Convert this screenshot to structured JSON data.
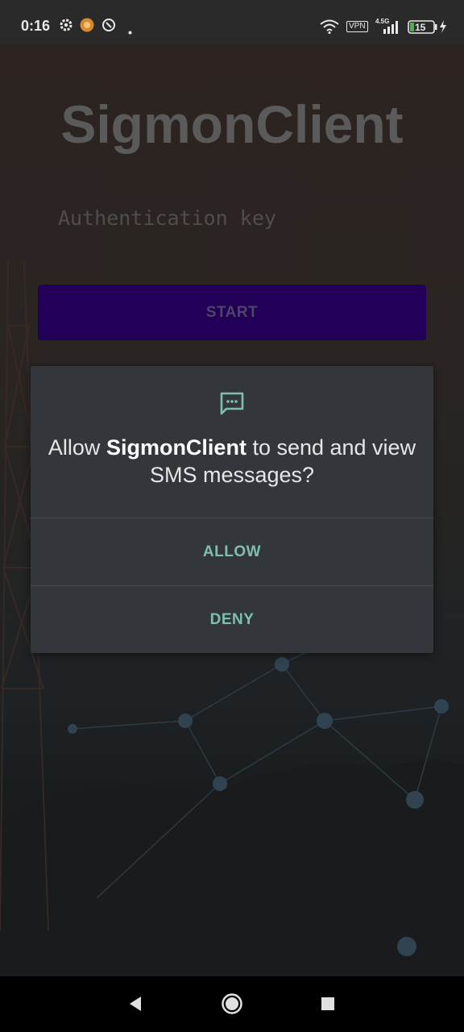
{
  "status_bar": {
    "time": "0:16",
    "icons": [
      "gear-icon",
      "notification-app-icon",
      "location-off-icon",
      "dot-icon"
    ],
    "network_type": "4.5G",
    "vpn_label": "VPN",
    "battery_level": "15",
    "charging": true
  },
  "app": {
    "title": "SigmonClient",
    "auth_placeholder": "Authentication key",
    "start_label": "START"
  },
  "dialog": {
    "icon": "message-icon",
    "text_prefix": "Allow ",
    "app_name": "SigmonClient",
    "text_suffix": " to send and view SMS messages?",
    "allow_label": "ALLOW",
    "deny_label": "DENY",
    "accent_color": "#7fbfb0"
  },
  "nav_bar": {
    "buttons": [
      "back-icon",
      "home-icon",
      "recents-icon"
    ]
  }
}
